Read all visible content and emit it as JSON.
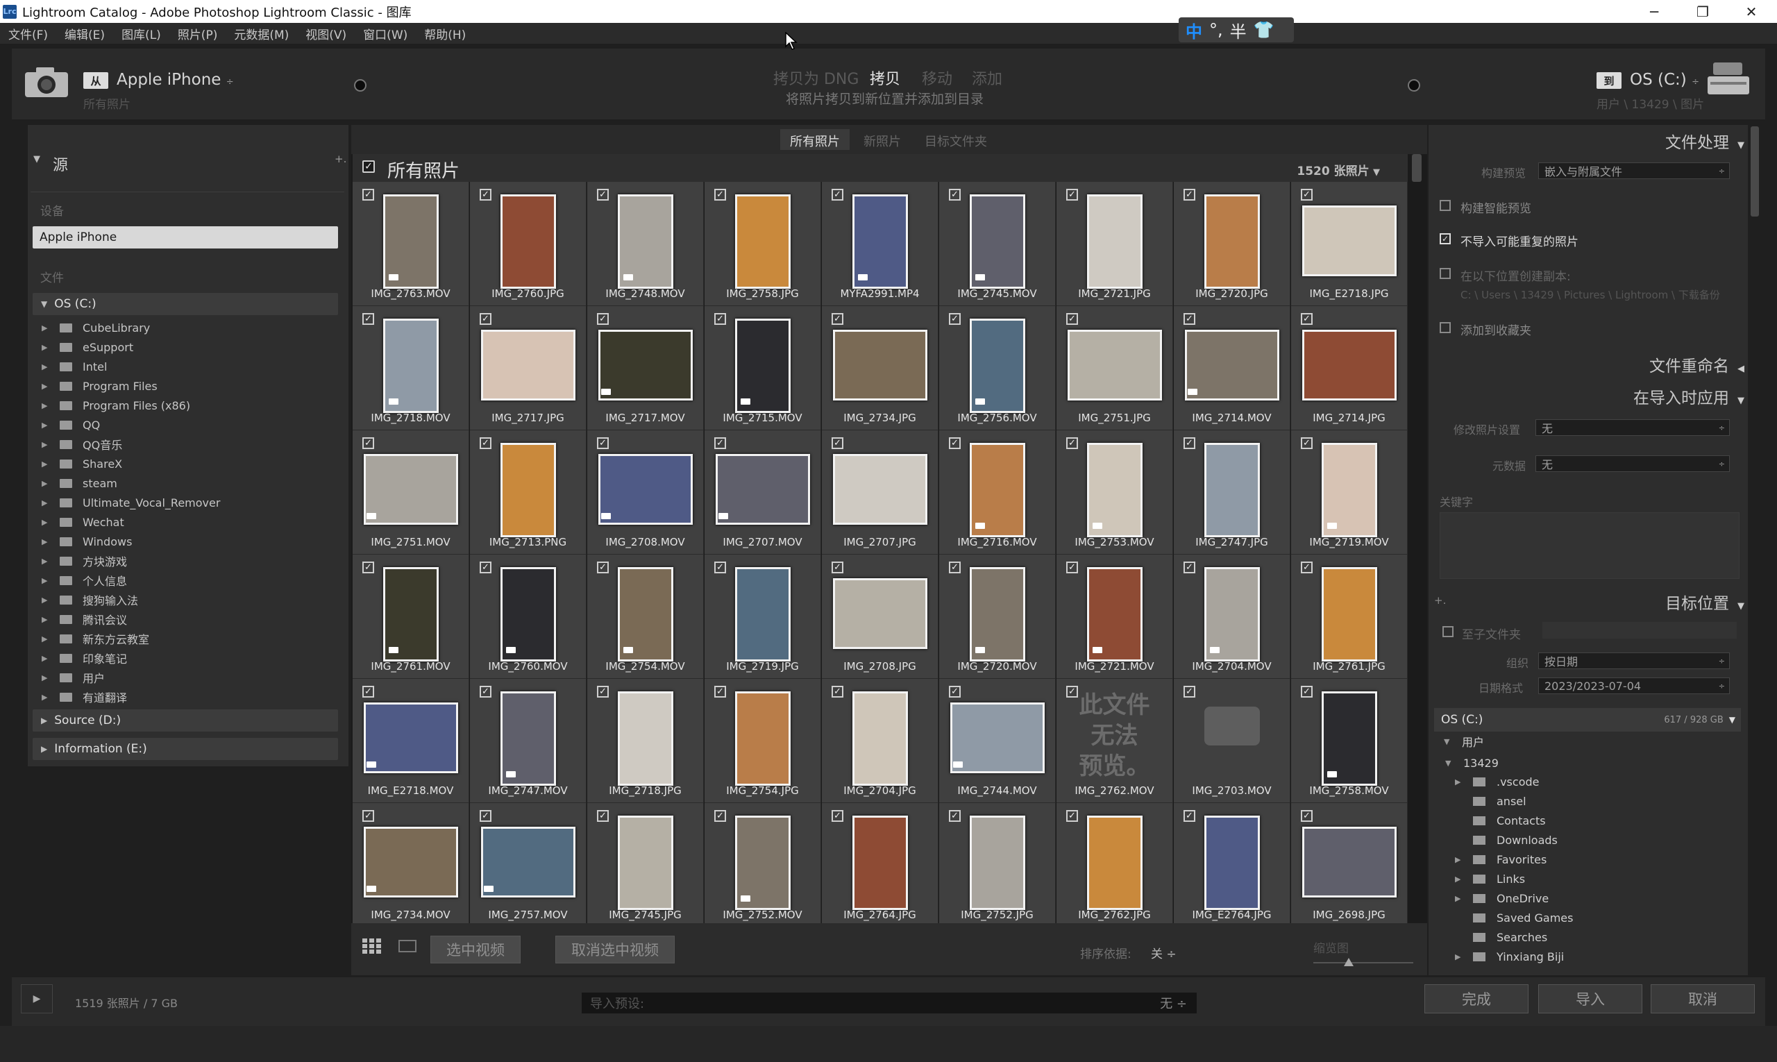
{
  "window": {
    "title": "Lightroom Catalog - Adobe Photoshop Lightroom Classic - 图库",
    "logo": "Lrc"
  },
  "menu": [
    "文件(F)",
    "编辑(E)",
    "图库(L)",
    "照片(P)",
    "元数据(M)",
    "视图(V)",
    "窗口(W)",
    "帮助(H)"
  ],
  "ime": {
    "lang": "中",
    "punct": "°,",
    "width": "半"
  },
  "header": {
    "source_badge": "从",
    "source_name": "Apple iPhone",
    "source_sub": "所有照片",
    "modes": [
      "拷贝为 DNG",
      "拷贝",
      "移动",
      "添加"
    ],
    "mode_sub": "将照片拷贝到新位置并添加到目录",
    "dest_badge": "到",
    "dest_name": "OS (C:)",
    "dest_sub": "用户 \\ 13429 \\ 图片"
  },
  "left": {
    "title": "源",
    "plus": "+.",
    "devices_label": "设备",
    "device": "Apple iPhone",
    "files_label": "文件",
    "drive_c": "OS (C:)",
    "folders": [
      "CubeLibrary",
      "eSupport",
      "Intel",
      "Program Files",
      "Program Files (x86)",
      "QQ",
      "QQ音乐",
      "ShareX",
      "steam",
      "Ultimate_Vocal_Remover",
      "Wechat",
      "Windows",
      "方块游戏",
      "个人信息",
      "搜狗输入法",
      "腾讯会议",
      "新东方云教室",
      "印象笔记",
      "用户",
      "有道翻译"
    ],
    "drive_d": "Source (D:)",
    "drive_e": "Information (E:)"
  },
  "tabs": [
    "所有照片",
    "新照片",
    "目标文件夹"
  ],
  "grid_header": {
    "title": "所有照片",
    "count": "1520 张照片"
  },
  "photos": [
    "IMG_2763.MOV",
    "IMG_2760.JPG",
    "IMG_2748.MOV",
    "IMG_2758.JPG",
    "MYFA2991.MP4",
    "IMG_2745.MOV",
    "IMG_2721.JPG",
    "IMG_2720.JPG",
    "IMG_E2718.JPG",
    "IMG_2718.MOV",
    "IMG_2717.JPG",
    "IMG_2717.MOV",
    "IMG_2715.MOV",
    "IMG_2734.JPG",
    "IMG_2756.MOV",
    "IMG_2751.JPG",
    "IMG_2714.MOV",
    "IMG_2714.JPG",
    "IMG_2751.MOV",
    "IMG_2713.PNG",
    "IMG_2708.MOV",
    "IMG_2707.MOV",
    "IMG_2707.JPG",
    "IMG_2716.MOV",
    "IMG_2753.MOV",
    "IMG_2747.JPG",
    "IMG_2719.MOV",
    "IMG_2761.MOV",
    "IMG_2760.MOV",
    "IMG_2754.MOV",
    "IMG_2719.JPG",
    "IMG_2708.JPG",
    "IMG_2720.MOV",
    "IMG_2721.MOV",
    "IMG_2704.MOV",
    "IMG_2761.JPG",
    "IMG_E2718.MOV",
    "IMG_2747.MOV",
    "IMG_2718.JPG",
    "IMG_2754.JPG",
    "IMG_2704.JPG",
    "IMG_2744.MOV",
    "IMG_2762.MOV",
    "IMG_2703.MOV",
    "IMG_2758.MOV",
    "IMG_2734.MOV",
    "IMG_2757.MOV",
    "IMG_2745.JPG",
    "IMG_2752.MOV",
    "IMG_2764.JPG",
    "IMG_2752.JPG",
    "IMG_2762.JPG",
    "IMG_E2764.JPG",
    "IMG_2698.JPG"
  ],
  "no_preview": "此文件\n无法\n预览。",
  "bottom": {
    "select_video": "选中视频",
    "deselect_video": "取消选中视频",
    "sort_label": "排序依据:",
    "sort_value": "关 ÷",
    "thumb_label": "缩览图"
  },
  "right": {
    "file_handling": "文件处理",
    "build_preview_label": "构建预览",
    "build_preview_value": "嵌入与附属文件",
    "smart_preview": "构建智能预览",
    "no_duplicates": "不导入可能重复的照片",
    "second_copy": "在以下位置创建副本:",
    "second_copy_path": "C: \\ Users \\ 13429 \\ Pictures \\ Lightroom \\ 下载备份",
    "add_collection": "添加到收藏夹",
    "file_rename": "文件重命名",
    "apply_during_import": "在导入时应用",
    "develop_label": "修改照片设置",
    "develop_value": "无",
    "metadata_label": "元数据",
    "metadata_value": "无",
    "keywords_label": "关键字",
    "destination": "目标位置",
    "into_subfolder": "至子文件夹",
    "organize_label": "组织",
    "organize_value": "按日期",
    "date_format_label": "日期格式",
    "date_format_value": "2023/2023-07-04",
    "drive": "OS (C:)",
    "drive_space": "617 / 928 GB",
    "user_folder": "用户",
    "user_name": "13429",
    "folders": [
      ".vscode",
      "ansel",
      "Contacts",
      "Downloads",
      "Favorites",
      "Links",
      "OneDrive",
      "Saved Games",
      "Searches",
      "Yinxiang Biji"
    ]
  },
  "footer": {
    "status": "1519 张照片 / 7 GB",
    "preset_label": "导入预设:",
    "preset_value": "无 ÷",
    "done": "完成",
    "import": "导入",
    "cancel": "取消"
  }
}
